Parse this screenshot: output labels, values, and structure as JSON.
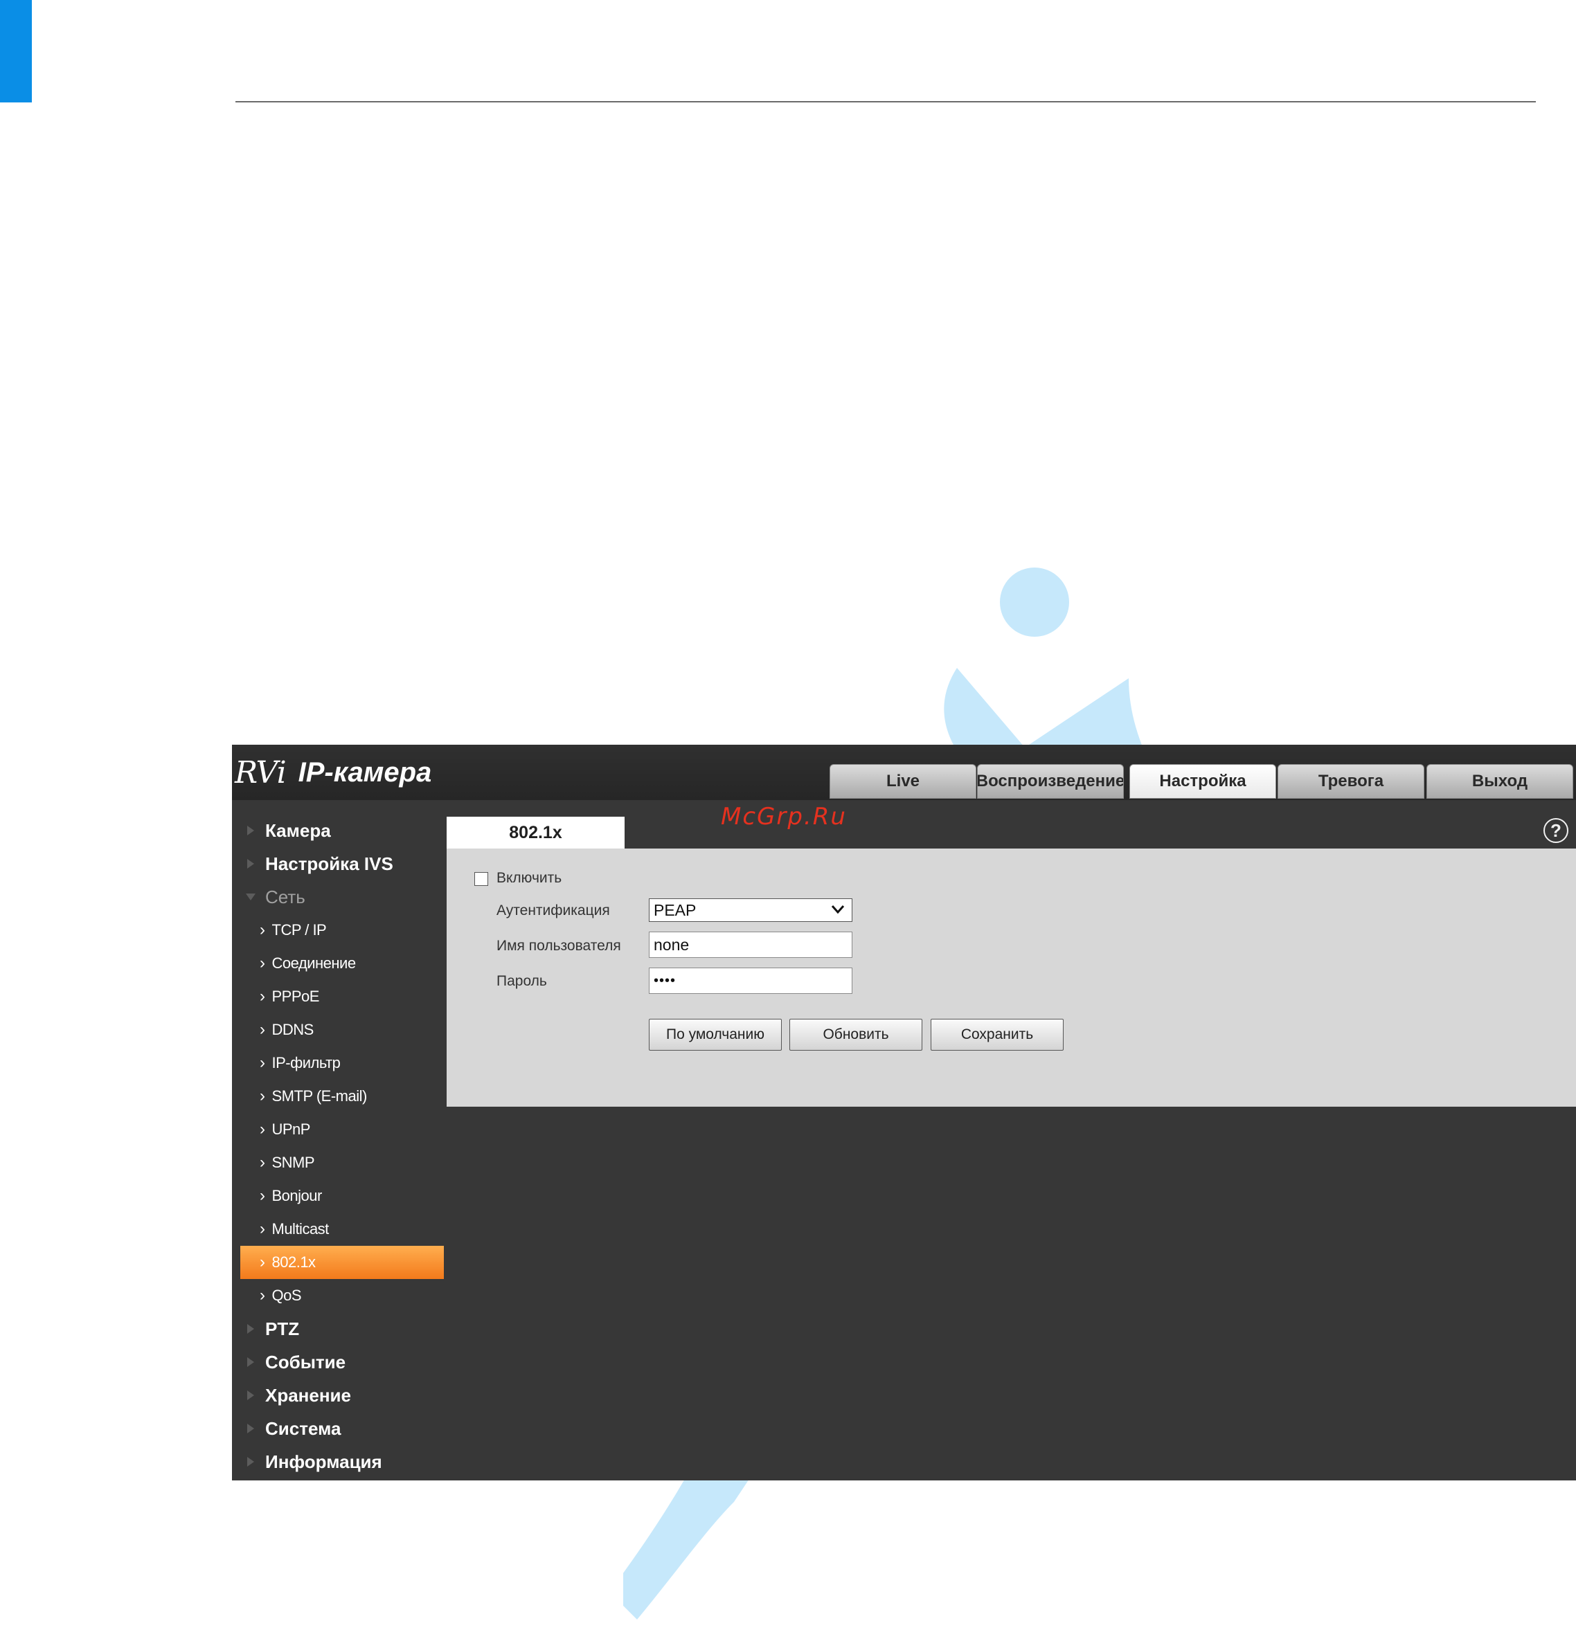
{
  "app": {
    "logo_brand": "RVi",
    "logo_title": "IP-камера"
  },
  "tabs": [
    {
      "label": "Live",
      "active": false
    },
    {
      "label": "Воспроизведение",
      "active": false
    },
    {
      "label": "Настройка",
      "active": true
    },
    {
      "label": "Тревога",
      "active": false
    },
    {
      "label": "Выход",
      "active": false
    }
  ],
  "sidebar": {
    "top_items": [
      "Камера",
      "Настройка IVS",
      "Сеть"
    ],
    "sub_items": [
      "TCP / IP",
      "Соединение",
      "PPPoE",
      "DDNS",
      "IP-фильтр",
      "SMTP (E-mail)",
      "UPnP",
      "SNMP",
      "Bonjour",
      "Multicast",
      "802.1x",
      "QoS"
    ],
    "active_sub": "802.1x",
    "bottom_items": [
      "PTZ",
      "Событие",
      "Хранение",
      "Система",
      "Информация"
    ]
  },
  "content": {
    "tab_label": "802.1x",
    "watermark": "McGrp.Ru",
    "help_icon": "?",
    "enable_label": "Включить",
    "enable_checked": false,
    "auth_label": "Аутентификация",
    "auth_value": "PEAP",
    "username_label": "Имя пользователя",
    "username_value": "none",
    "password_label": "Пароль",
    "password_value": "••••",
    "buttons": {
      "default": "По умолчанию",
      "refresh": "Обновить",
      "save": "Сохранить"
    }
  },
  "colors": {
    "accent_blue": "#0a8ee6",
    "watermark_blue": "#c6e8fb",
    "active_nav": "#f7891f",
    "panel_bg": "#d7d7d7",
    "app_bg": "#373737"
  }
}
